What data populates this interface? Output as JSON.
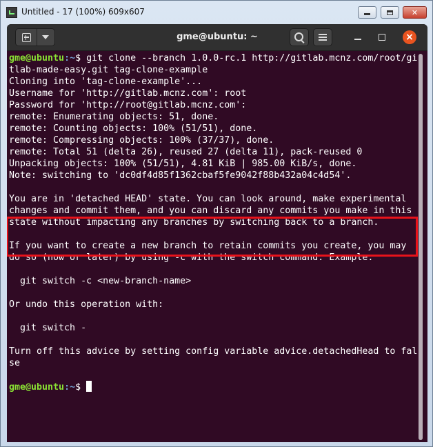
{
  "outer_window": {
    "title": "Untitled - 17 (100%) 609x607"
  },
  "terminal": {
    "title": "gme@ubuntu: ~",
    "lines": [
      {
        "user": "gme@ubuntu",
        "path": ":~",
        "symbol": "$ ",
        "text": "git clone --branch 1.0.0-rc.1 http://gitlab.mcnz.com/root/gi"
      },
      {
        "text": "tlab-made-easy.git tag-clone-example"
      },
      {
        "text": "Cloning into 'tag-clone-example'..."
      },
      {
        "text": "Username for 'http://gitlab.mcnz.com': root"
      },
      {
        "text": "Password for 'http://root@gitlab.mcnz.com':"
      },
      {
        "text": "remote: Enumerating objects: 51, done."
      },
      {
        "text": "remote: Counting objects: 100% (51/51), done."
      },
      {
        "text": "remote: Compressing objects: 100% (37/37), done."
      },
      {
        "text": "remote: Total 51 (delta 26), reused 27 (delta 11), pack-reused 0"
      },
      {
        "text": "Unpacking objects: 100% (51/51), 4.81 KiB | 985.00 KiB/s, done."
      },
      {
        "text": "Note: switching to 'dc0df4d85f1362cbaf5fe9042f88b432a04c4d54'."
      },
      {
        "text": ""
      },
      {
        "text": "You are in 'detached HEAD' state. You can look around, make experimental"
      },
      {
        "text": "changes and commit them, and you can discard any commits you make in this"
      },
      {
        "text": "state without impacting any branches by switching back to a branch."
      },
      {
        "text": ""
      },
      {
        "text": "If you want to create a new branch to retain commits you create, you may"
      },
      {
        "text": "do so (now or later) by using -c with the switch command. Example:"
      },
      {
        "text": ""
      },
      {
        "text": "  git switch -c <new-branch-name>"
      },
      {
        "text": ""
      },
      {
        "text": "Or undo this operation with:"
      },
      {
        "text": ""
      },
      {
        "text": "  git switch -"
      },
      {
        "text": ""
      },
      {
        "text": "Turn off this advice by setting config variable advice.detachedHead to fal"
      },
      {
        "text": "se"
      },
      {
        "text": ""
      },
      {
        "user": "gme@ubuntu",
        "path": ":~",
        "symbol": "$ ",
        "text": "",
        "cursor": true
      }
    ]
  },
  "colors": {
    "terminal_bg": "#300a24",
    "prompt_user": "#8ae234",
    "prompt_path": "#729fcf",
    "highlight_box": "#e8131b",
    "close_button": "#e95420"
  },
  "icons": {
    "new_tab": "new-tab-icon",
    "menu": "chevron-down-icon",
    "search": "search-icon",
    "hamburger": "hamburger-menu-icon",
    "minimize": "minimize-icon",
    "maximize": "maximize-icon",
    "close": "close-icon"
  }
}
